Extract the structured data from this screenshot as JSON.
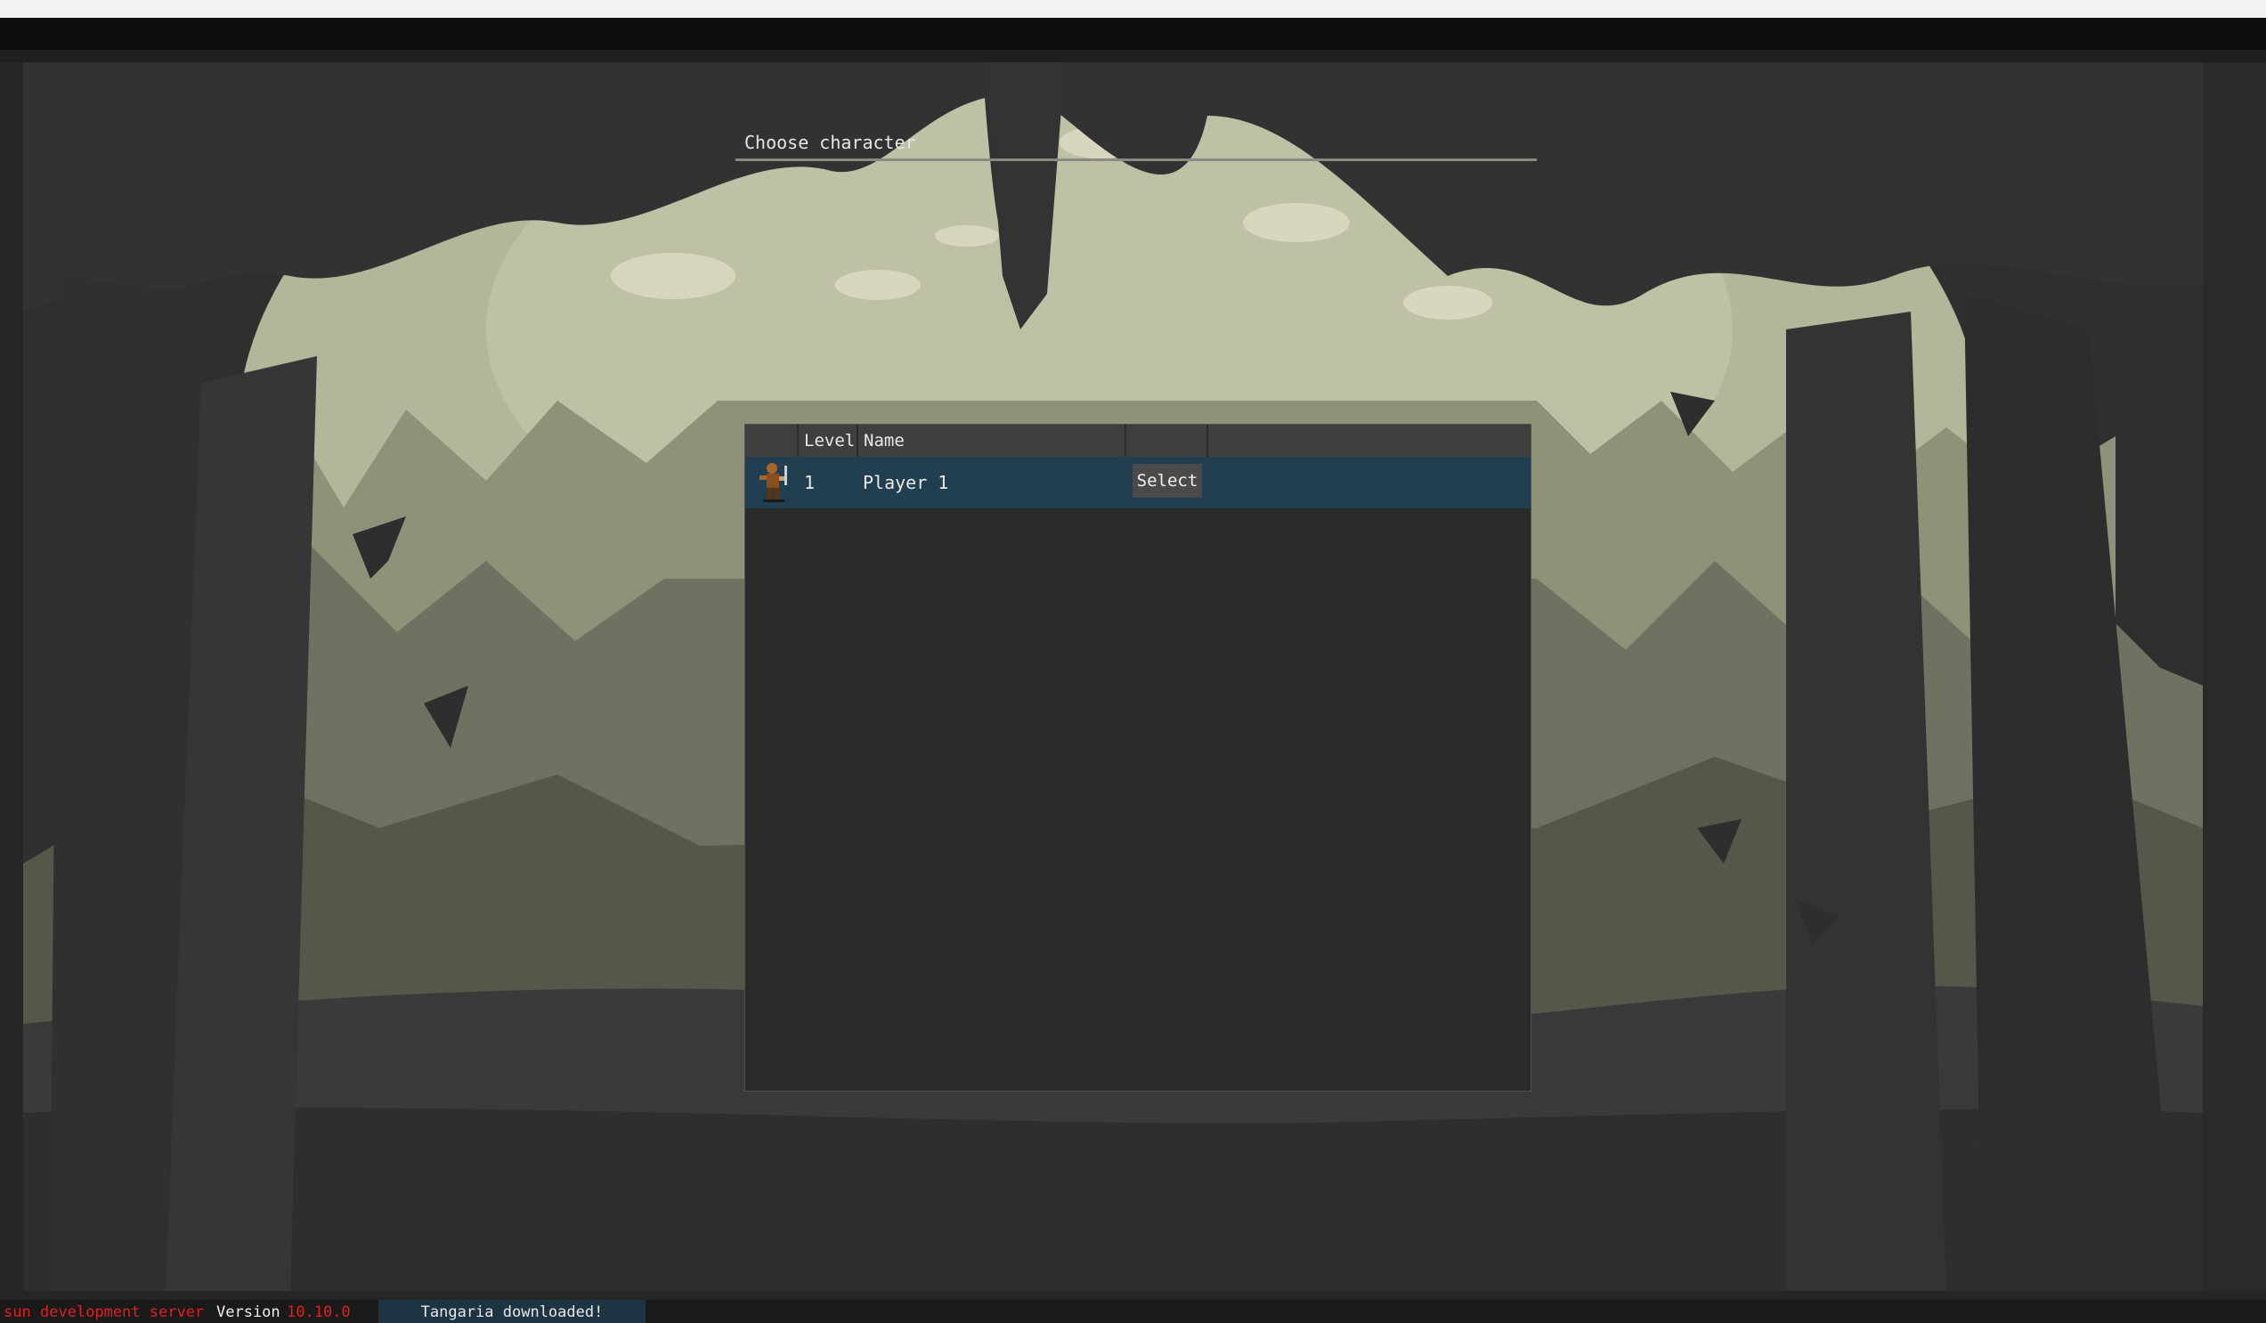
{
  "window": {
    "title": "Choose character"
  },
  "table": {
    "columns": [
      "",
      "Level",
      "Name",
      "",
      ""
    ],
    "rows": [
      {
        "avatar_icon": "warrior-avatar-icon",
        "level": "1",
        "name": "Player 1",
        "action_label": "Select"
      }
    ]
  },
  "status_bar": {
    "server": "sun development server",
    "version_label": "Version",
    "version_value": "10.10.0",
    "notification": "Tangaria downloaded!"
  },
  "colors": {
    "selected_row": "#213f51",
    "server_text": "#e02020",
    "version_value": "#e02020",
    "notification_bg": "#1d3442",
    "header_bg": "#3f3f3f",
    "window_bg": "#2a2a2a"
  }
}
